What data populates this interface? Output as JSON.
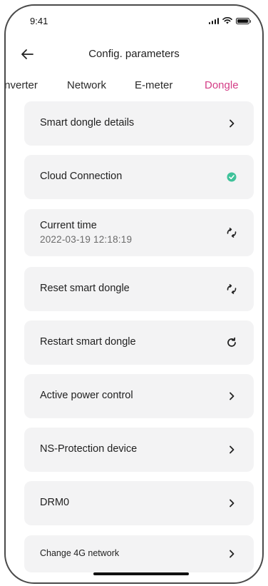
{
  "status_bar": {
    "time": "9:41"
  },
  "header": {
    "title": "Config. parameters"
  },
  "tabs": [
    {
      "label": "Inverter",
      "active": false
    },
    {
      "label": "Network",
      "active": false
    },
    {
      "label": "E-meter",
      "active": false
    },
    {
      "label": "Dongle",
      "active": true
    }
  ],
  "colors": {
    "accent": "#d43d86",
    "success": "#3fc29a",
    "card_bg": "#f3f3f4"
  },
  "items": [
    {
      "label": "Smart dongle details",
      "icon": "chevron-right-icon"
    },
    {
      "label": "Cloud Connection",
      "icon": "check-circle-icon"
    },
    {
      "label": "Current time",
      "value": "2022-03-19 12:18:19",
      "icon": "sync-icon"
    },
    {
      "label": "Reset smart dongle",
      "icon": "sync-icon"
    },
    {
      "label": "Restart smart dongle",
      "icon": "refresh-icon"
    },
    {
      "label": "Active power control",
      "icon": "chevron-right-icon"
    },
    {
      "label": "NS-Protection device",
      "icon": "chevron-right-icon"
    },
    {
      "label": "DRM0",
      "icon": "chevron-right-icon"
    },
    {
      "label": "Change 4G network",
      "icon": "chevron-right-icon"
    }
  ]
}
